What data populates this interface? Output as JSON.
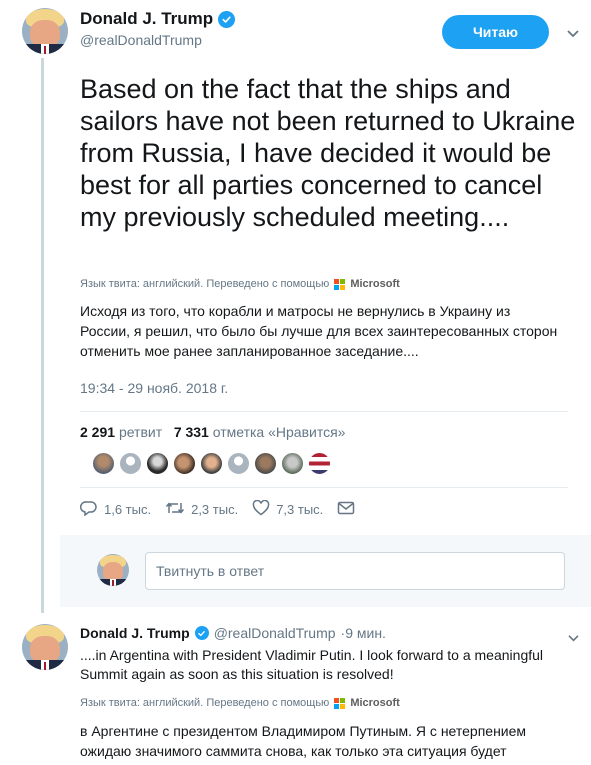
{
  "tweet": {
    "author_name": "Donald J. Trump",
    "author_handle": "@realDonaldTrump",
    "follow_label": "Читаю",
    "text": "Based on the fact that the ships and sailors have not been returned to Ukraine from Russia, I have decided it would be best for all parties concerned to cancel my previously scheduled meeting....",
    "translation_note": "Язык твита: английский. Переведено с помощью",
    "translator": "Microsoft",
    "translated_text": "Исходя из того, что корабли и матросы не вернулись в Украину из России, я решил, что было бы лучше для всех заинтересованных сторон отменить мое ранее запланированное заседание....",
    "timestamp": "19:34 - 29 нояб. 2018 г.",
    "retweet_count": "2 291",
    "retweet_label": "ретвит",
    "like_count": "7 331",
    "like_label": "отметка «Нравится»",
    "reply_action": "1,6 тыс.",
    "retweet_action": "2,3 тыс.",
    "like_action": "7,3 тыс.",
    "icons": {
      "reply": "reply-icon",
      "retweet": "retweet-icon",
      "like": "heart-icon",
      "dm": "envelope-icon",
      "verified": "verified-badge-icon",
      "menu": "chevron-down-icon"
    }
  },
  "reply_box": {
    "placeholder": "Твитнуть в ответ"
  },
  "second_tweet": {
    "author_name": "Donald J. Trump",
    "author_handle": "@realDonaldTrump",
    "time": "·9 мин.",
    "text": "....in Argentina with President Vladimir Putin. I look forward to a meaningful Summit again as soon as this situation is resolved!",
    "translation_note": "Язык твита: английский. Переведено с помощью",
    "translator": "Microsoft",
    "translated_text": "в Аргентине с президентом Владимиром Путиным. Я с нетерпением ожидаю значимого саммита снова, как только эта ситуация будет решена!"
  },
  "colors": {
    "accent": "#1da1f2",
    "secondary_text": "#657786",
    "divider": "#e6ecf0"
  }
}
